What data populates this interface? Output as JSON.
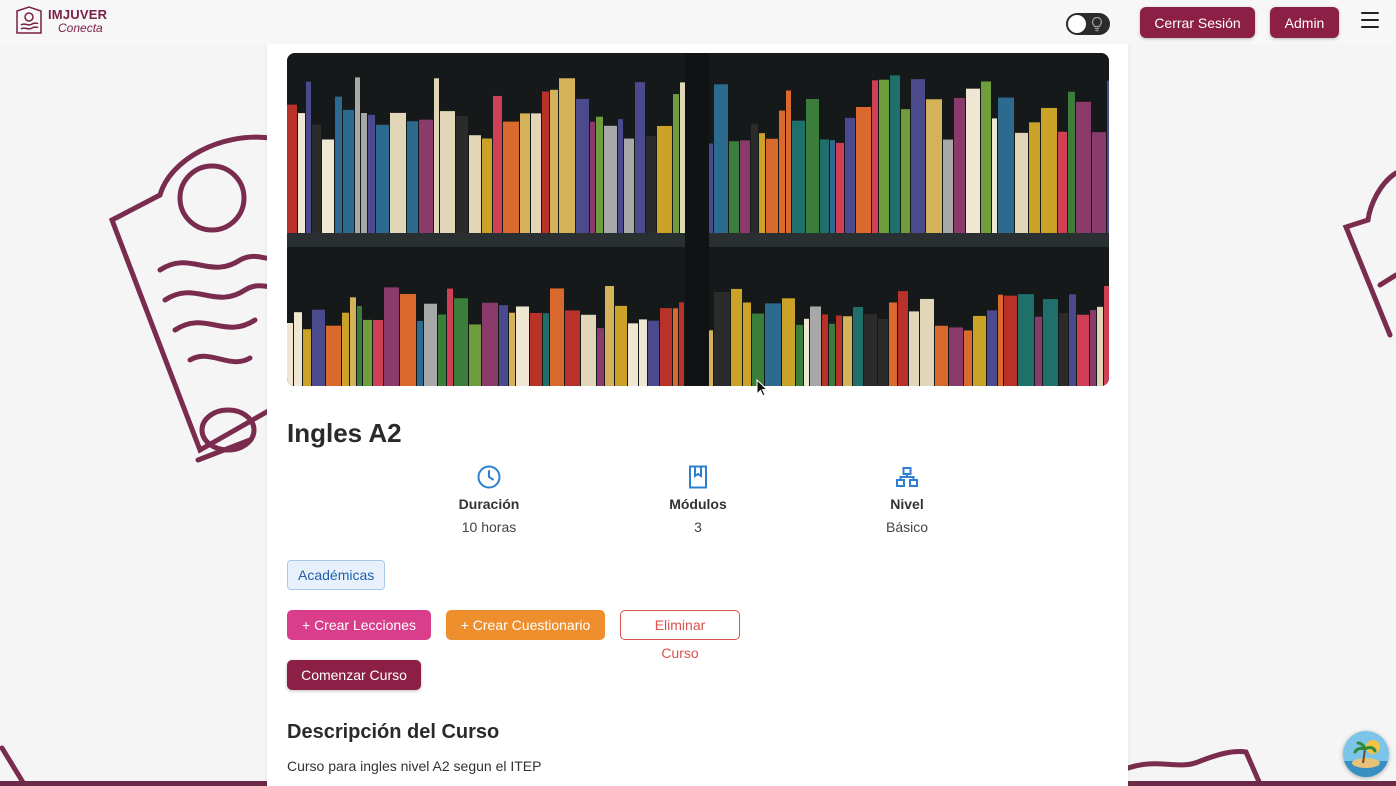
{
  "navbar": {
    "logo_title": "IMJUVER",
    "logo_subtitle": "Conecta",
    "logout_label": "Cerrar Sesión",
    "admin_label": "Admin"
  },
  "course": {
    "title": "Ingles A2",
    "stats": [
      {
        "icon": "clock-icon",
        "label": "Duración",
        "value": "10 horas"
      },
      {
        "icon": "book-icon",
        "label": "Módulos",
        "value": "3"
      },
      {
        "icon": "level-hierarchy-icon",
        "label": "Nivel",
        "value": "Básico"
      }
    ],
    "category_tag": "Académicas",
    "actions": {
      "create_lessons": "Crear Lecciones",
      "create_quiz": "Crear Cuestionario",
      "delete_course": "Eliminar Curso",
      "start_course": "Comenzar Curso"
    },
    "description_heading": "Descripción del Curso",
    "description_text": "Curso para ingles nivel A2 segun el ITEP"
  },
  "colors": {
    "brand": "#8c1f45",
    "pink_button": "#d93d8b",
    "orange_button": "#ee8e2c",
    "danger": "#d9534f",
    "tag_blue": "#1f5fa8",
    "icon_blue": "#2f7fd0"
  }
}
